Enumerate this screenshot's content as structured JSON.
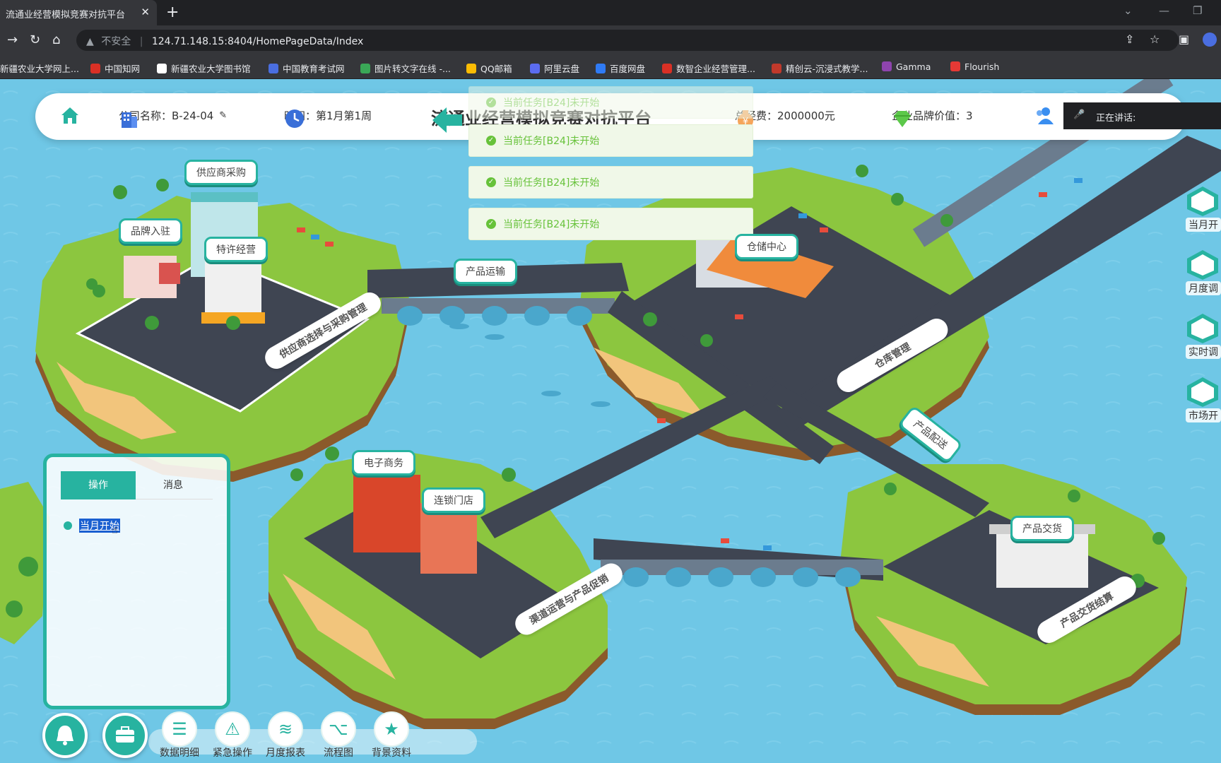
{
  "browser": {
    "tab_title": "流通业经营模拟竞赛对抗平台",
    "insecure_label": "不安全",
    "url": "124.71.148.15:8404/HomePageData/Index",
    "bookmarks": [
      {
        "label": "新疆农业大学网上...",
        "color": "#3a7bd5"
      },
      {
        "label": "中国知网",
        "color": "#d93025"
      },
      {
        "label": "新疆农业大学图书馆",
        "color": "#ffffff"
      },
      {
        "label": "中国教育考试网",
        "color": "#4a6ee0"
      },
      {
        "label": "图片转文字在线 -...",
        "color": "#3aa757"
      },
      {
        "label": "QQ邮箱",
        "color": "#fbbc04"
      },
      {
        "label": "阿里云盘",
        "color": "#5b6cf0"
      },
      {
        "label": "百度网盘",
        "color": "#2f7bf5"
      },
      {
        "label": "数智企业经营管理...",
        "color": "#d93025"
      },
      {
        "label": "精创云-沉浸式教学...",
        "color": "#c0392b"
      },
      {
        "label": "Gamma",
        "color": "#8e44ad"
      },
      {
        "label": "Flourish",
        "color": "#e53935"
      }
    ]
  },
  "header": {
    "company": "公司名称：B-24-04",
    "time": "时间：第1月第1周",
    "title": "流通业经营模拟竞赛对抗平台",
    "total_funds": "总经费：2000000元",
    "brand_value": "企业品牌价值：3",
    "speaking": "正在讲话:"
  },
  "toasts": [
    "当前任务[B24]未开始",
    "当前任务[B24]未开始",
    "当前任务[B24]未开始",
    "当前任务[B24]未开始"
  ],
  "map_labels": {
    "supplier": "供应商采购",
    "brand": "品牌入驻",
    "franchise": "特许经营",
    "transport": "产品运输",
    "warehouse": "仓储中心",
    "ecommerce": "电子商务",
    "chain": "连锁门店",
    "delivery": "产品配送",
    "handover": "产品交货"
  },
  "road_labels": {
    "supplier_mgmt": "供应商选择与采购管理",
    "warehouse_mgmt": "仓库管理",
    "channel_mgmt": "渠道运营与产品促销",
    "handover_mgmt": "产品交货结算"
  },
  "panel": {
    "tab_operate": "操作",
    "tab_messages": "消息",
    "item": "当月开始"
  },
  "toolbar": [
    "数据明细",
    "紧急操作",
    "月度报表",
    "流程图",
    "背景资料"
  ],
  "side_buttons": [
    "当月开",
    "月度调",
    "实时调",
    "市场开"
  ],
  "colors": {
    "accent": "#27b3a0",
    "water": "#6fc7e6",
    "grass": "#8cc63f",
    "toast_text": "#67c23a"
  }
}
